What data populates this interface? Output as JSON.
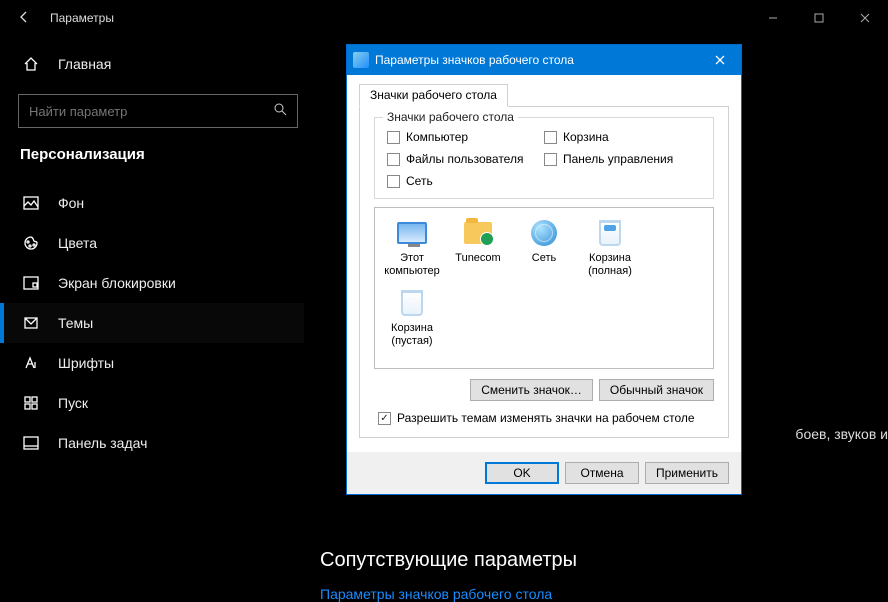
{
  "window": {
    "title": "Параметры"
  },
  "sidebar": {
    "home": "Главная",
    "search_placeholder": "Найти параметр",
    "category": "Персонализация",
    "items": [
      {
        "label": "Фон"
      },
      {
        "label": "Цвета"
      },
      {
        "label": "Экран блокировки"
      },
      {
        "label": "Темы"
      },
      {
        "label": "Шрифты"
      },
      {
        "label": "Пуск"
      },
      {
        "label": "Панель задач"
      }
    ]
  },
  "content": {
    "partial_text": "боев, звуков и",
    "related_header": "Сопутствующие параметры",
    "related_link": "Параметры значков рабочего стола"
  },
  "dialog": {
    "title": "Параметры значков рабочего стола",
    "tab": "Значки рабочего стола",
    "groupbox_title": "Значки рабочего стола",
    "checkboxes": {
      "computer": "Компьютер",
      "recycle": "Корзина",
      "userfiles": "Файлы пользователя",
      "cpanel": "Панель управления",
      "network": "Сеть"
    },
    "icons": {
      "this_pc": "Этот компьютер",
      "tunecom": "Tunecom",
      "network": "Сеть",
      "bin_full": "Корзина (полная)",
      "bin_empty": "Корзина (пустая)"
    },
    "change_icon_btn": "Сменить значок…",
    "default_icon_btn": "Обычный значок",
    "allow_themes": "Разрешить темам изменять значки на рабочем столе",
    "ok": "OK",
    "cancel": "Отмена",
    "apply": "Применить"
  }
}
